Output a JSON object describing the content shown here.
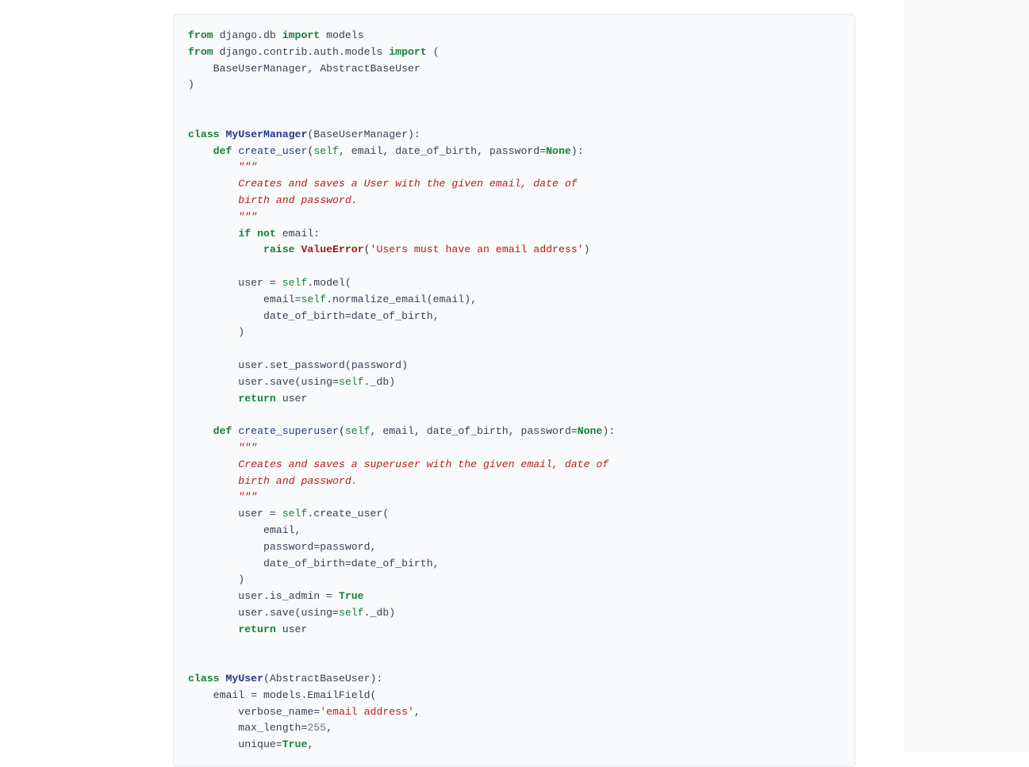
{
  "code": {
    "line1_from": "from",
    "line1_mod": "django.db",
    "line1_import": "import",
    "line1_name": "models",
    "line2_from": "from",
    "line2_mod": "django.contrib.auth.models",
    "line2_import": "import",
    "line2_paren": "(",
    "line3": "    BaseUserManager, AbstractBaseUser",
    "line4": ")",
    "line7_class": "class",
    "line7_name": "MyUserManager",
    "line7_rest": "(BaseUserManager):",
    "line8_def": "def",
    "line8_name": "create_user",
    "line8_self": "self",
    "line8_params": ", email, date_of_birth, password=",
    "line8_none": "None",
    "line8_end": "):",
    "doc1_q": "        \"\"\"",
    "doc1_l1": "        Creates and saves a User with the given email, date of",
    "doc1_l2": "        birth and password.",
    "doc1_qe": "        \"\"\"",
    "line13_if": "if",
    "line13_not": "not",
    "line13_email": " email:",
    "line14_raise": "raise",
    "line14_exc": "ValueError",
    "line14_msg": "'Users must have an email address'",
    "line14_end": ")",
    "line16_a": "        user = ",
    "line16_self": "self",
    "line16_b": ".model(",
    "line17_a": "            email=",
    "line17_self": "self",
    "line17_b": ".normalize_email(email),",
    "line18": "            date_of_birth=date_of_birth,",
    "line19": "        )",
    "line21": "        user.set_password(password)",
    "line22_a": "        user.save(using=",
    "line22_self": "self",
    "line22_b": "._db)",
    "line23_ret": "return",
    "line23_user": " user",
    "line25_def": "def",
    "line25_name": "create_superuser",
    "line25_self": "self",
    "line25_params": ", email, date_of_birth, password=",
    "line25_none": "None",
    "line25_end": "):",
    "doc2_q": "        \"\"\"",
    "doc2_l1": "        Creates and saves a superuser with the given email, date of",
    "doc2_l2": "        birth and password.",
    "doc2_qe": "        \"\"\"",
    "line30_a": "        user = ",
    "line30_self": "self",
    "line30_b": ".create_user(",
    "line31": "            email,",
    "line32": "            password=password,",
    "line33": "            date_of_birth=date_of_birth,",
    "line34": "        )",
    "line35_a": "        user.is_admin = ",
    "line35_true": "True",
    "line36_a": "        user.save(using=",
    "line36_self": "self",
    "line36_b": "._db)",
    "line37_ret": "return",
    "line37_user": " user",
    "line40_class": "class",
    "line40_name": "MyUser",
    "line40_rest": "(AbstractBaseUser):",
    "line41": "    email = models.EmailField(",
    "line42_a": "        verbose_name=",
    "line42_s": "'email address'",
    "line42_b": ",",
    "line43_a": "        max_length=",
    "line43_n": "255",
    "line43_b": ",",
    "line44_a": "        unique=",
    "line44_true": "True",
    "line44_b": ","
  }
}
